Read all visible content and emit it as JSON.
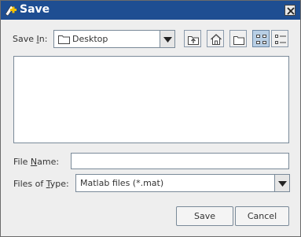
{
  "window": {
    "title": "Save",
    "icons": {
      "app": "save-add-icon",
      "close": "close-icon"
    }
  },
  "save_in": {
    "label_prefix": "Save ",
    "label_mnemonic": "I",
    "label_suffix": "n:",
    "value": "Desktop",
    "icon": "folder-icon"
  },
  "toolbar": {
    "buttons": [
      {
        "icon": "up-one-level-icon"
      },
      {
        "icon": "home-icon"
      },
      {
        "icon": "new-folder-icon"
      },
      {
        "icon": "list-view-icon",
        "active": true
      },
      {
        "icon": "details-view-icon"
      }
    ]
  },
  "file_list": {
    "items": []
  },
  "file_name": {
    "label_prefix": "File ",
    "label_mnemonic": "N",
    "label_suffix": "ame:",
    "value": ""
  },
  "file_type": {
    "label_prefix": "Files of ",
    "label_mnemonic": "T",
    "label_suffix": "ype:",
    "value": "Matlab files (*.mat)"
  },
  "actions": {
    "save_label": "Save",
    "cancel_label": "Cancel"
  },
  "colors": {
    "titlebar": "#1e4e92",
    "dialog_bg": "#eeeeee",
    "border": "#7a8a99",
    "active_button": "#b8cfe5"
  }
}
